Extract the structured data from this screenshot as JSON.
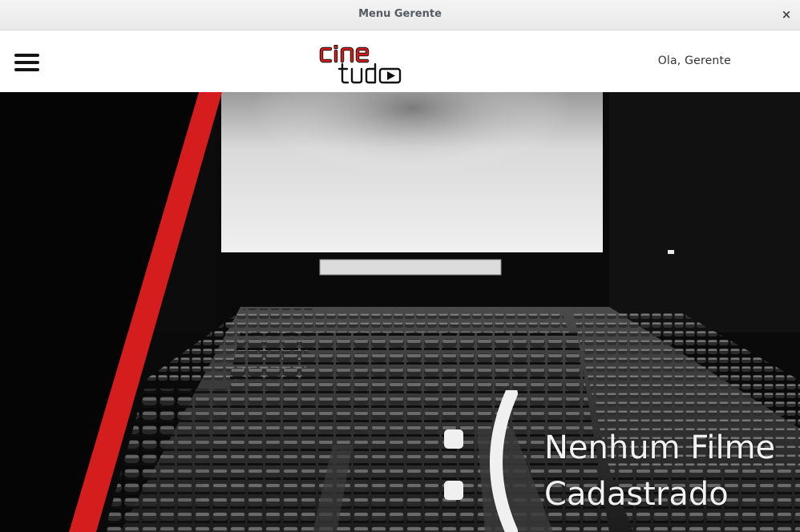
{
  "window": {
    "title": "Menu Gerente",
    "close_glyph": "×"
  },
  "header": {
    "menu_icon": "hamburger-menu-icon",
    "logo": {
      "line1": "cine",
      "line2": "tudo",
      "play_icon": "play-icon"
    },
    "greeting": "Ola, Gerente"
  },
  "hero": {
    "background": "cinema-auditorium-image",
    "empty_emoticon": ":(",
    "empty_line1": "Nenhum Filme",
    "empty_line2": "Cadastrado"
  },
  "colors": {
    "accent_red": "#d51d1d",
    "header_bg": "#ffffff",
    "titlebar_bg": "#eeeeee"
  }
}
